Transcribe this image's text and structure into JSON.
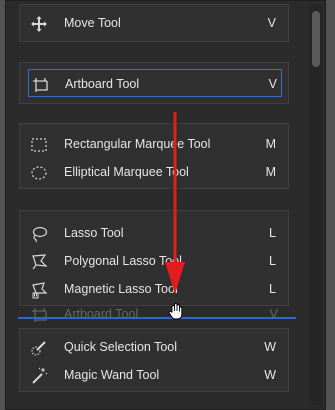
{
  "groups": [
    {
      "rows": [
        {
          "icon": "move-icon",
          "label": "Move Tool",
          "key": "V"
        }
      ]
    },
    {
      "rows": [
        {
          "icon": "artboard-icon",
          "label": "Artboard Tool",
          "key": "V",
          "selected": true
        }
      ]
    },
    {
      "rows": [
        {
          "icon": "rectangular-marquee-icon",
          "label": "Rectangular Marquee Tool",
          "key": "M"
        },
        {
          "icon": "elliptical-marquee-icon",
          "label": "Elliptical Marquee Tool",
          "key": "M"
        }
      ]
    },
    {
      "rows": [
        {
          "icon": "lasso-icon",
          "label": "Lasso Tool",
          "key": "L"
        },
        {
          "icon": "polygonal-lasso-icon",
          "label": "Polygonal Lasso Tool",
          "key": "L"
        },
        {
          "icon": "magnetic-lasso-icon",
          "label": "Magnetic Lasso Tool",
          "key": "L"
        }
      ]
    },
    {
      "rows": [
        {
          "icon": "quick-selection-icon",
          "label": "Quick Selection Tool",
          "key": "W"
        },
        {
          "icon": "magic-wand-icon",
          "label": "Magic Wand Tool",
          "key": "W"
        }
      ]
    }
  ],
  "drag_ghost": {
    "icon": "artboard-icon",
    "label": "Artboard Tool",
    "key": "V"
  },
  "colors": {
    "accent": "#3a6ec5",
    "arrow": "#e11d1d",
    "panel": "#2b2b2b",
    "text": "#e6e6e6"
  }
}
